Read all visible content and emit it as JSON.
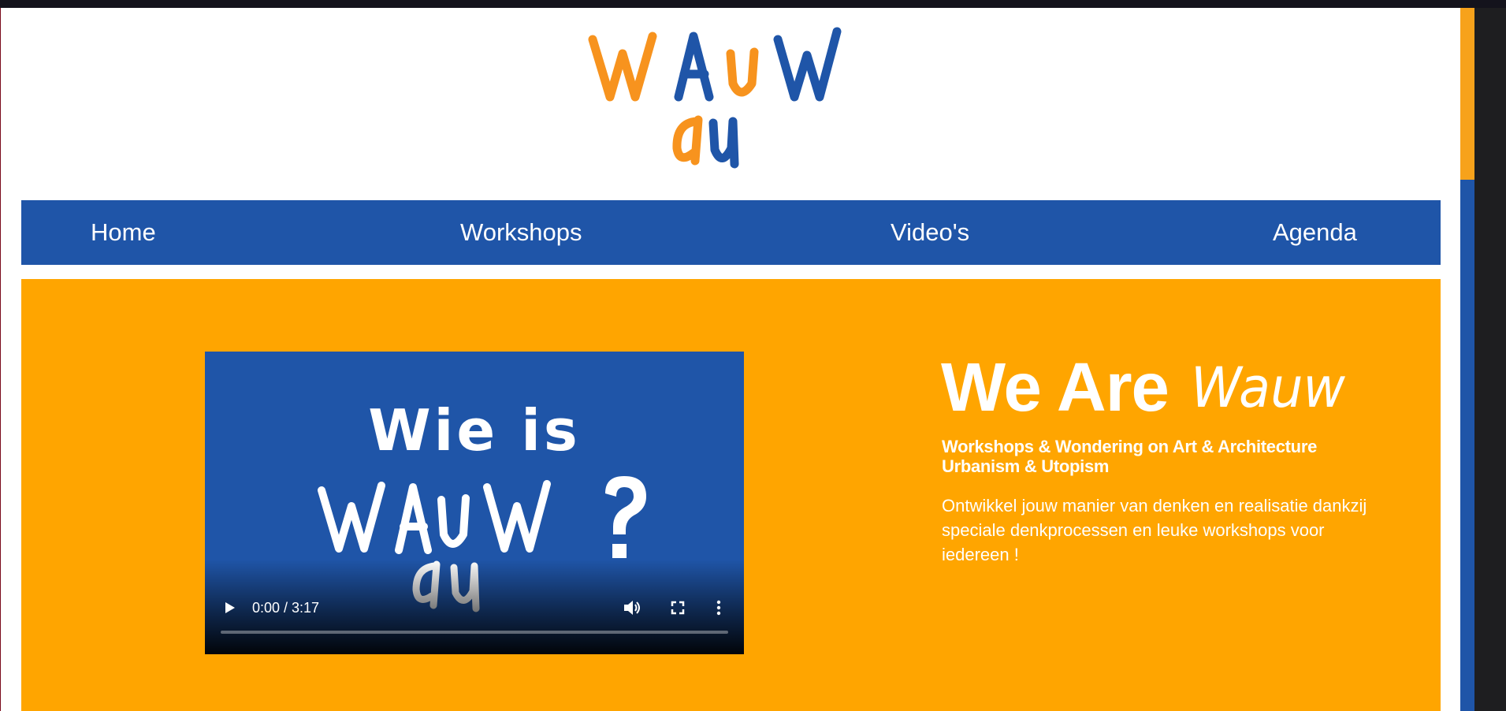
{
  "logo": {
    "top_letters": [
      "W",
      "A",
      "U",
      "W"
    ],
    "bottom_letters": [
      "a",
      "u"
    ]
  },
  "nav": {
    "items": [
      {
        "label": "Home"
      },
      {
        "label": "Workshops"
      },
      {
        "label": "Video's"
      },
      {
        "label": "Agenda"
      }
    ]
  },
  "video": {
    "poster_line1": "Wie is",
    "poster_line2": "WAUW?",
    "poster_line3": "au",
    "time": "0:00 / 3:17",
    "progress": 0
  },
  "hero": {
    "title_plain": "We Are",
    "title_script": "Wauw",
    "subtitle_line1": "Workshops & Wondering on Art & Architecture",
    "subtitle_line2": "Urbanism & Utopism",
    "body": "Ontwikkel jouw manier van denken en realisatie dankzij speciale denkprocessen en leuke workshops voor iedereen !"
  },
  "colors": {
    "brand_blue": "#1f55a8",
    "brand_orange": "#ffa500",
    "logo_orange": "#f7931e",
    "logo_blue": "#1f55a8"
  },
  "icons": [
    "play-icon",
    "volume-icon",
    "fullscreen-icon",
    "more-options-icon"
  ]
}
